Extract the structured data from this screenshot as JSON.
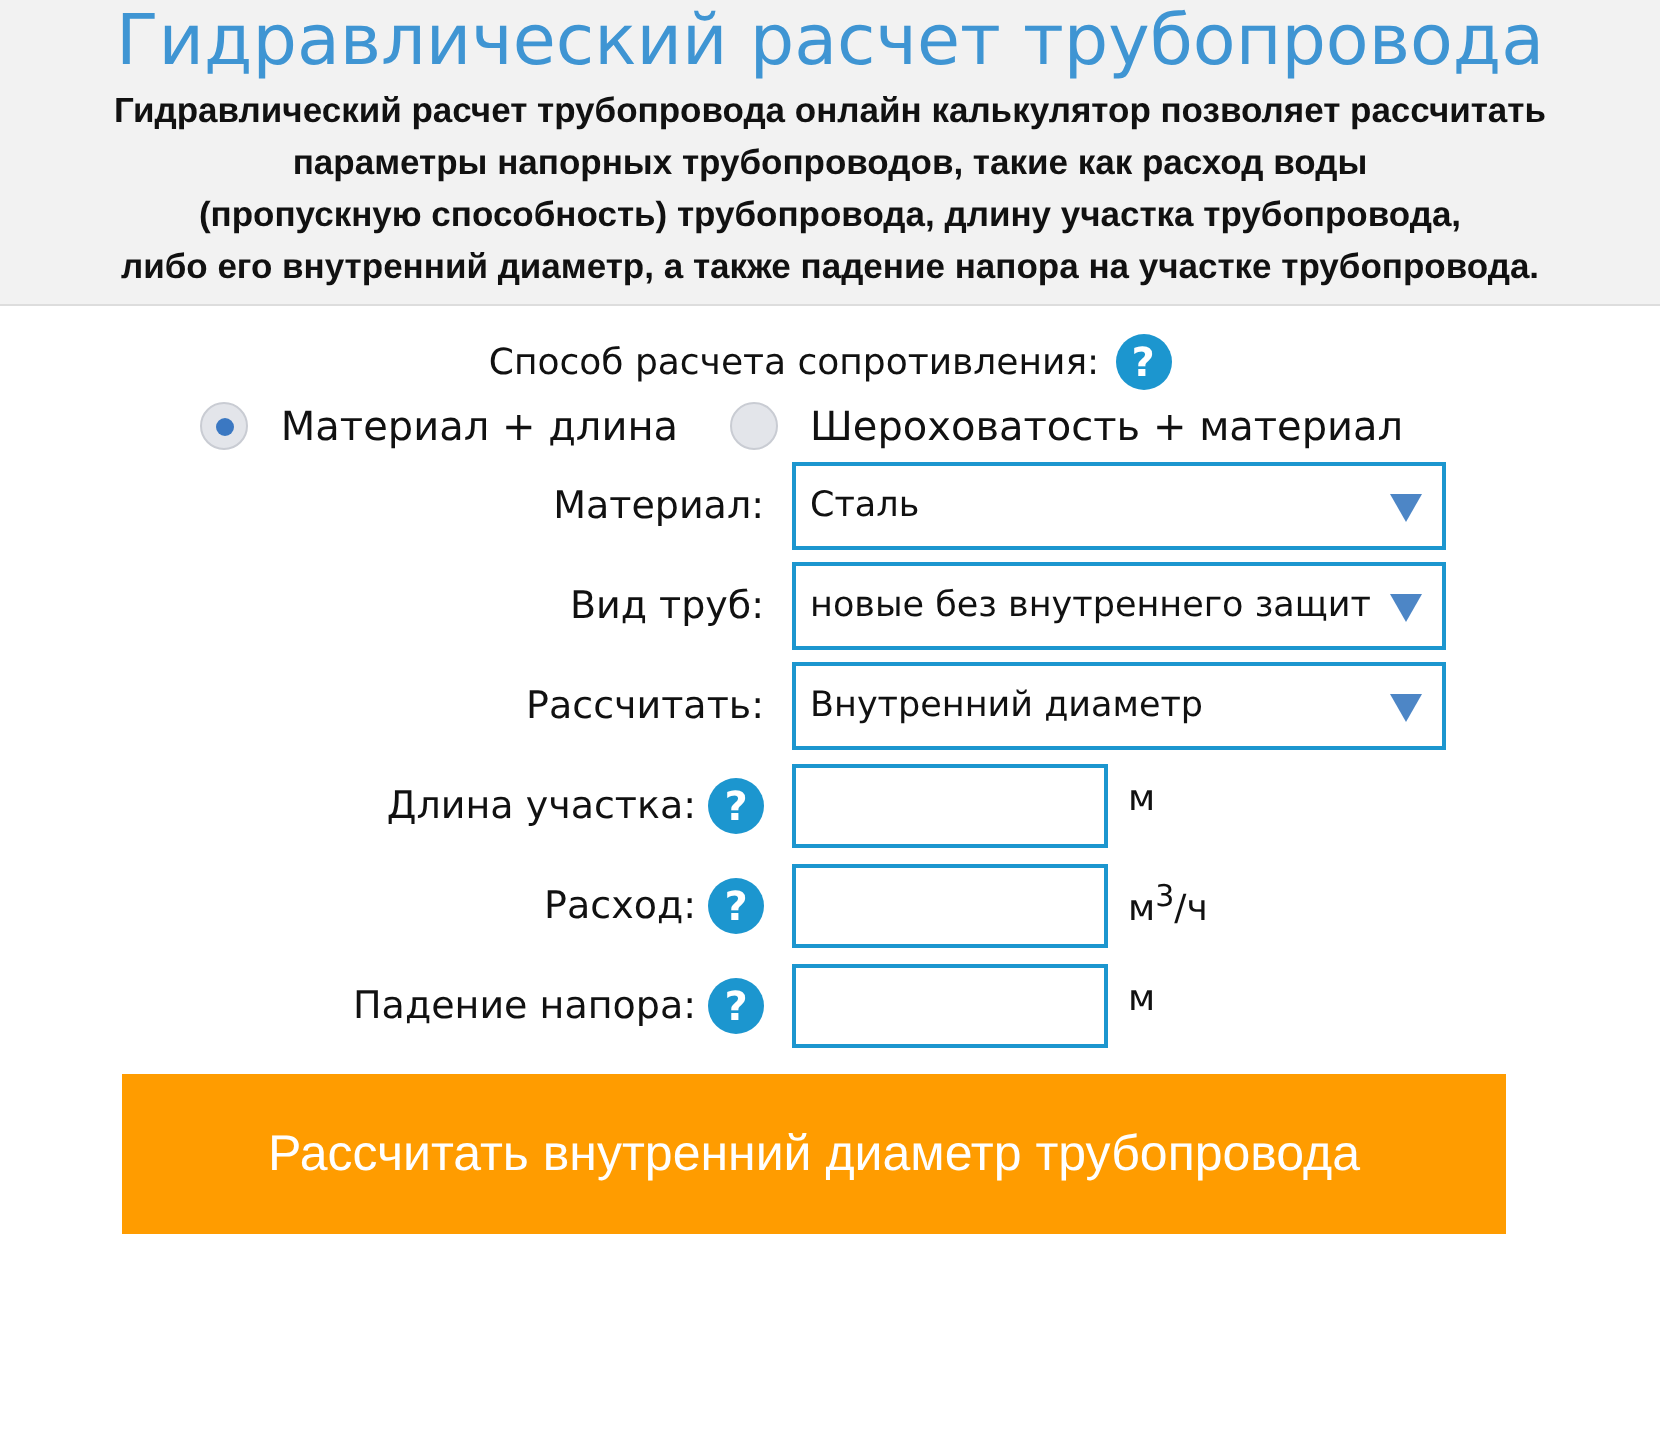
{
  "header": {
    "title": "Гидравлический расчет трубопровода",
    "description": [
      "Гидравлический расчет трубопровода онлайн калькулятор позволяет рассчитать",
      "параметры напорных трубопроводов, такие как расход воды",
      "(пропускную способность) трубопровода, длину участка трубопровода,",
      "либо его внутренний диаметр, а также падение напора на участке трубопровода."
    ]
  },
  "method": {
    "label": "Способ расчета сопротивления:",
    "help": "?",
    "options": [
      {
        "label": "Материал + длина",
        "selected": true
      },
      {
        "label": "Шероховатость + материал",
        "selected": false
      }
    ]
  },
  "selects": [
    {
      "label": "Материал:",
      "value": "Сталь"
    },
    {
      "label": "Вид труб:",
      "value": "новые без внутреннего защит"
    },
    {
      "label": "Рассчитать:",
      "value": "Внутренний диаметр"
    }
  ],
  "inputs": [
    {
      "label": "Длина участка:",
      "help": "?",
      "unit": "м"
    },
    {
      "label": "Расход:",
      "help": "?",
      "unit": "м$^{3}$/ч"
    },
    {
      "label": "Падение напора:",
      "help": "?",
      "unit": "м"
    }
  ],
  "submit": "Рассчитать внутренний диаметр трубопровода"
}
